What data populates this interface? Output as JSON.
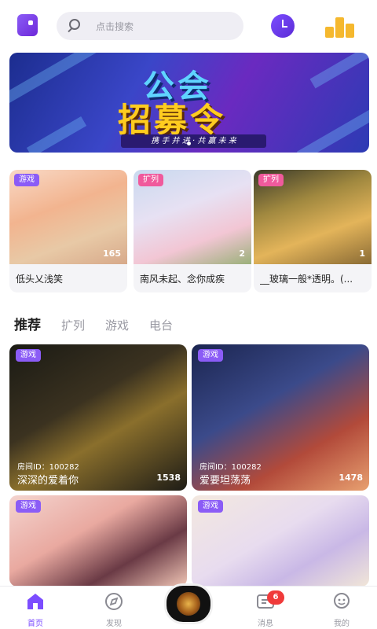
{
  "header": {
    "search_placeholder": "点击搜索",
    "icons": [
      "app-logo-icon",
      "search-icon",
      "history-clock-icon",
      "rank-trophy-icon"
    ]
  },
  "banner": {
    "title_line1": "公会",
    "title_line2": "招募令",
    "slogan": "携 手 并 进 · 共 赢 未 来",
    "accent": "#5fd3ff",
    "accent2": "#ffcc1f"
  },
  "top_rooms": [
    {
      "tag": "游戏",
      "tag_color": "#8b5cf6",
      "count": "165",
      "name": "低头乂浅笑"
    },
    {
      "tag": "扩列",
      "tag_color": "#f05a9c",
      "count": "2",
      "name": "南风未起、念你成疾"
    },
    {
      "tag": "扩列",
      "tag_color": "#f05a9c",
      "count": "1",
      "name": "__玻璃一般*透明。(..."
    }
  ],
  "tabs": [
    "推荐",
    "扩列",
    "游戏",
    "电台"
  ],
  "rooms": [
    {
      "tag": "游戏",
      "room_id": "房间ID：100282",
      "title": "深深的爱着你",
      "count": "1538"
    },
    {
      "tag": "游戏",
      "room_id": "房间ID：100282",
      "title": "爱要坦荡荡",
      "count": "1478"
    },
    {
      "tag": "游戏"
    },
    {
      "tag": "游戏"
    }
  ],
  "bottom_nav": {
    "home": "首页",
    "discover": "发现",
    "messages": "消息",
    "me": "我的",
    "message_badge": "6"
  },
  "colors": {
    "brand": "#7c4dff",
    "badge": "#f03a3a"
  }
}
